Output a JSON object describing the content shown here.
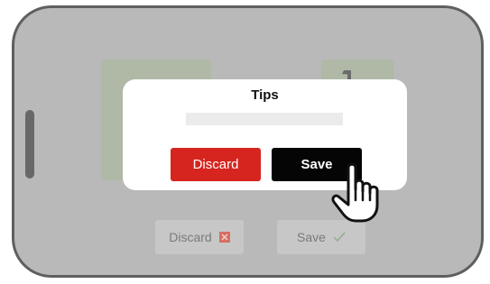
{
  "dialog": {
    "title": "Tips",
    "discard_label": "Discard",
    "save_label": "Save"
  },
  "background_actions": {
    "discard_label": "Discard",
    "save_label": "Save"
  },
  "icons": {
    "close": "close-icon",
    "check": "check-icon",
    "cursor": "hand-pointer-icon"
  },
  "colors": {
    "discard": "#d6251f",
    "save": "#050505",
    "overlay": "#b9b9b9"
  }
}
